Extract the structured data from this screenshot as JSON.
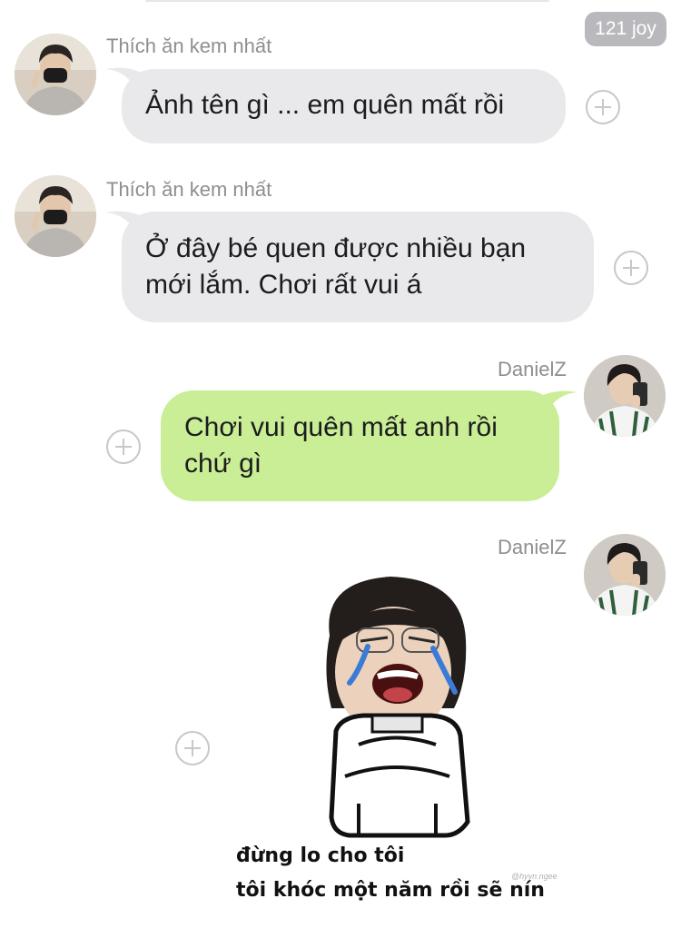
{
  "header": {
    "points_badge": "121 joy"
  },
  "messages": [
    {
      "sender": "Thích ăn kem nhất",
      "text": "Ảnh tên gì ... em quên mất rồi"
    },
    {
      "sender": "Thích ăn kem nhất",
      "line1": "Ở đây bé quen được nhiều bạn",
      "line2": "mới lắm. Chơi rất vui á"
    },
    {
      "sender": "DanielZ",
      "line1": "Chơi vui quên mất anh rồi",
      "line2": "chứ gì"
    },
    {
      "sender": "DanielZ",
      "sticker_caption_1": "đừng lo cho tôi",
      "sticker_caption_2": "tôi khóc một năm rồi sẽ nín",
      "sticker_watermark": "@hyyn.ngee"
    }
  ],
  "colors": {
    "incoming_bubble": "#e9e9eb",
    "outgoing_bubble": "#c9ee95",
    "badge": "#b9b9bd",
    "name_text": "#8e8e93"
  },
  "icons": {
    "add_reaction": "plus-circle-icon"
  }
}
